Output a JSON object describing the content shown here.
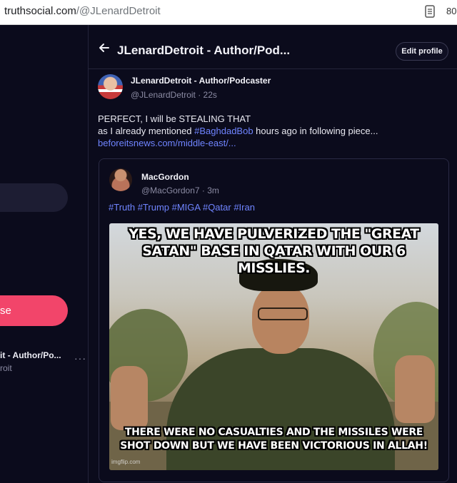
{
  "browser": {
    "url_host": "truthsocial.com",
    "url_path": "/@JLenardDetroit",
    "right_cut_text": "80"
  },
  "left_panel": {
    "button_label": "se",
    "account_name": "it - Author/Po...",
    "account_handle": "roit",
    "more": "···"
  },
  "header": {
    "title": "JLenardDetroit - Author/Pod...",
    "edit_profile": "Edit profile"
  },
  "post": {
    "author_name": "JLenardDetroit - Author/Podcaster",
    "author_handle": "@JLenardDetroit · 22s",
    "line1": "PERFECT, I will be STEALING THAT",
    "line2_prefix": "as I already mentioned ",
    "hashtag": "#BaghdadBob",
    "line2_suffix": " hours ago in following piece...",
    "link": "beforeitsnews.com/middle-east/..."
  },
  "quote": {
    "author_name": "MacGordon",
    "author_handle": "@MacGordon7 · 3m",
    "tags": "#Truth #Trump #MIGA #Qatar #Iran",
    "meme_top": "YES, WE HAVE PULVERIZED THE \"GREAT SATAN\" BASE IN QATAR WITH OUR 6 MISSLIES.",
    "meme_bottom": "THERE WERE NO CASUALTIES AND THE MISSILES WERE SHOT DOWN BUT WE HAVE BEEN VICTORIOUS IN ALLAH!",
    "watermark": "imgflip.com"
  }
}
